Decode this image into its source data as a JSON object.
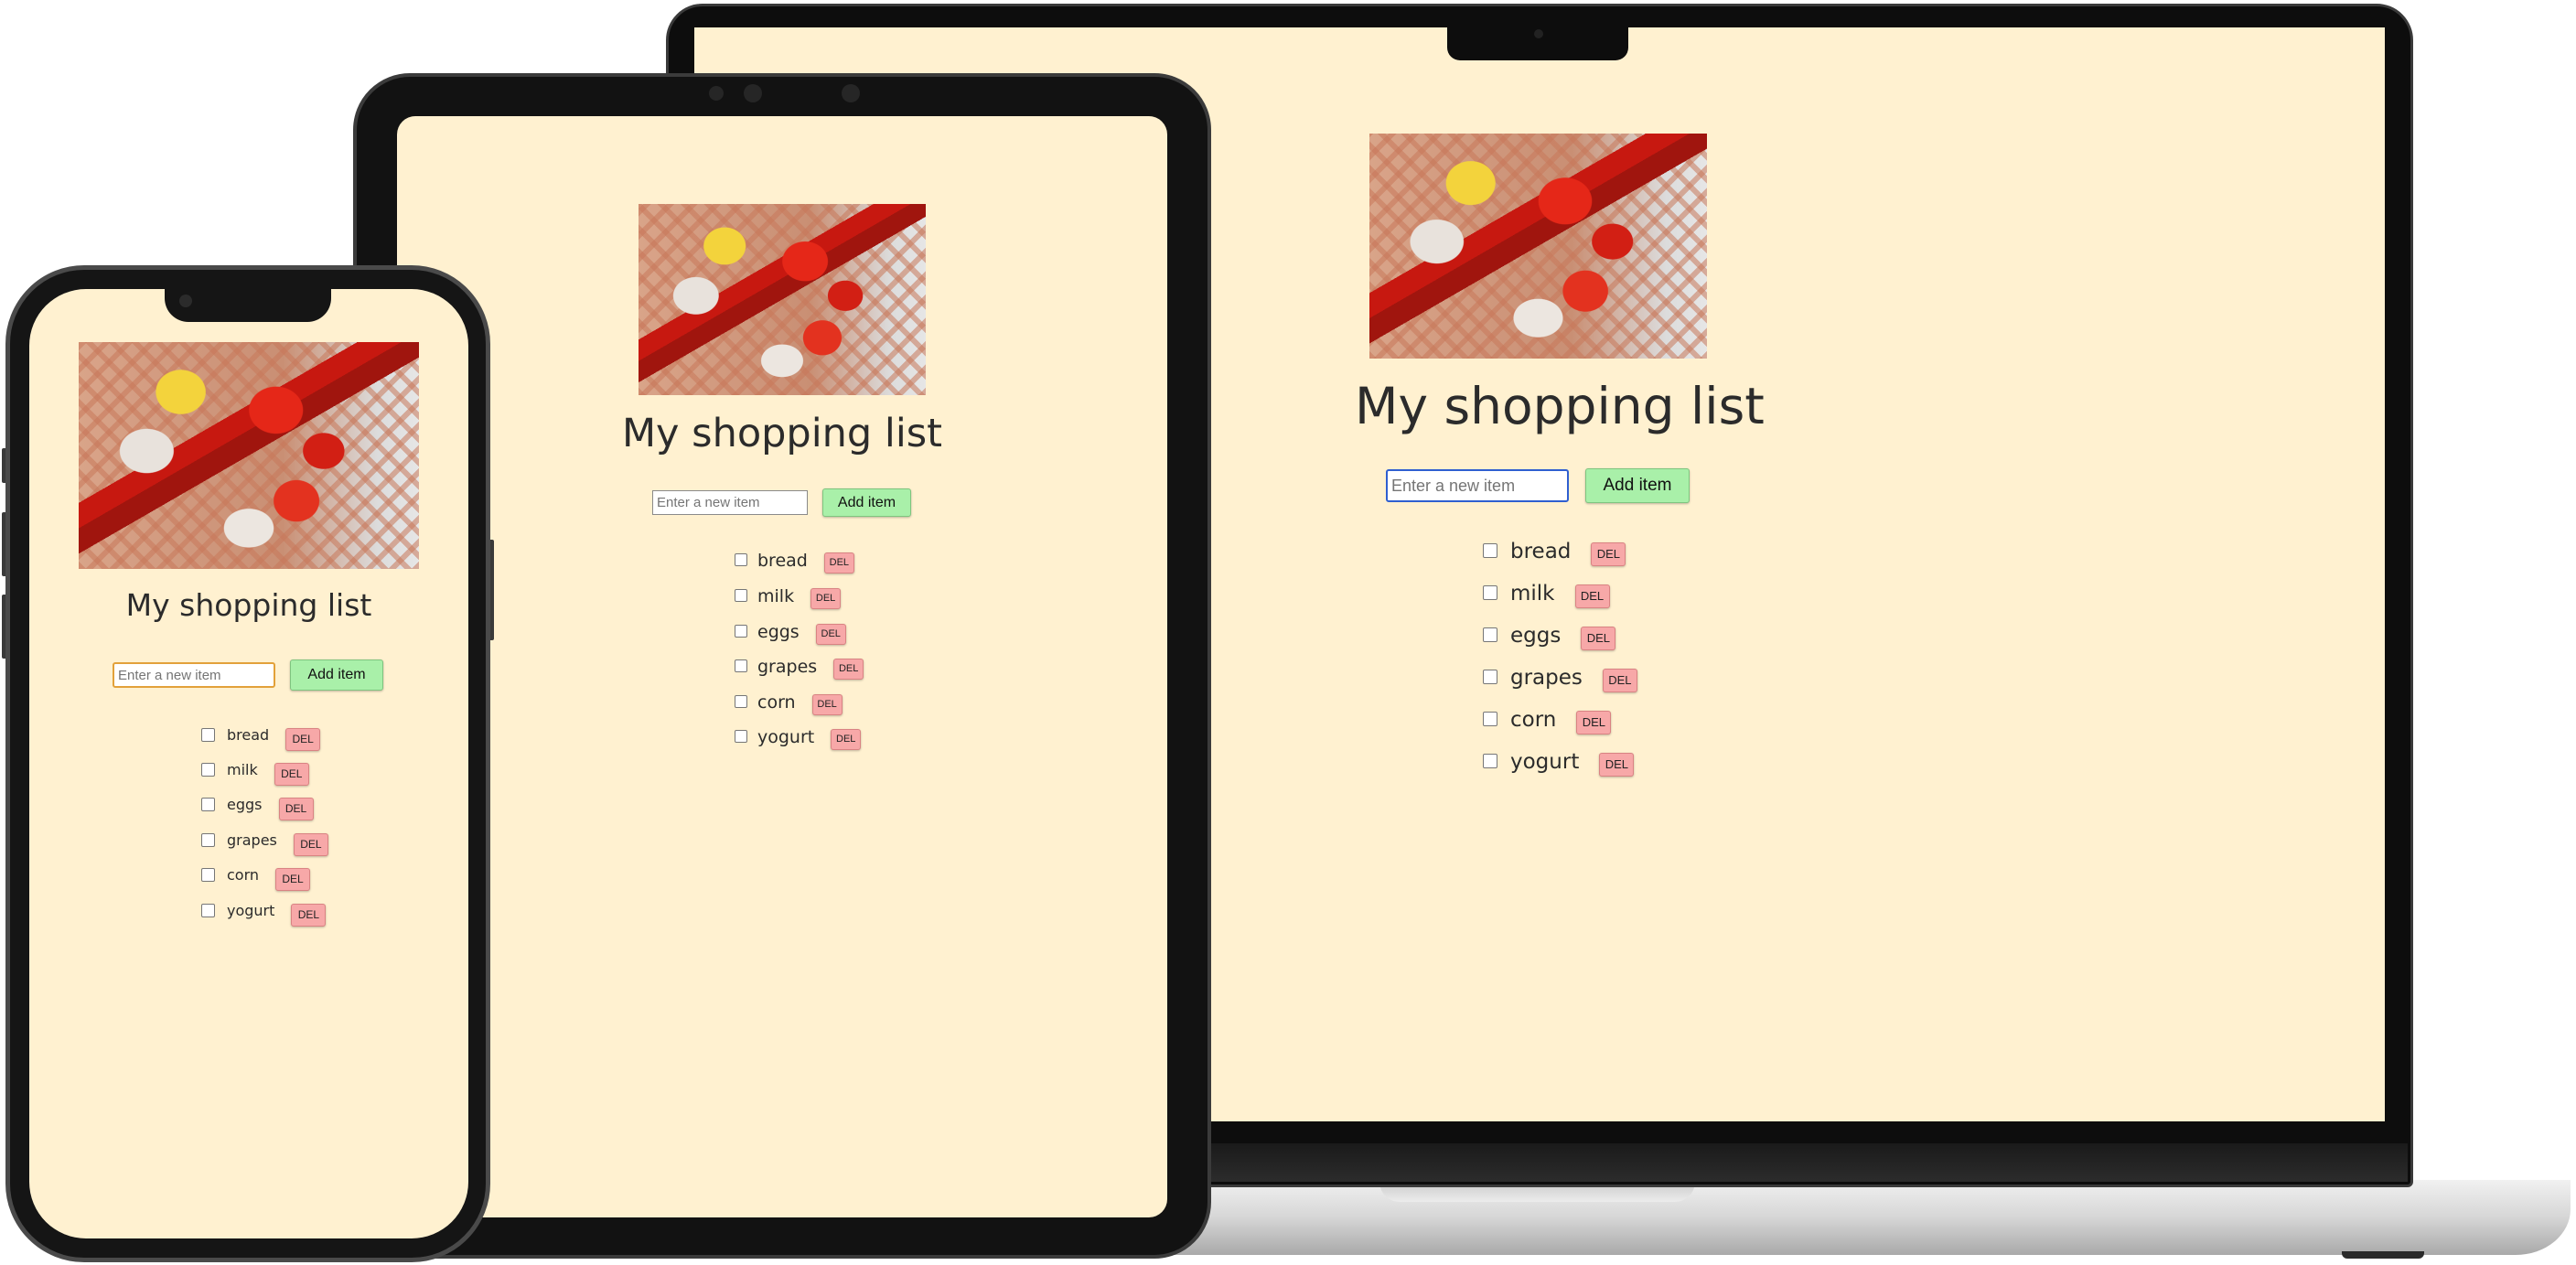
{
  "app": {
    "title": "My shopping list",
    "input_placeholder": "Enter a new item",
    "add_label": "Add item",
    "delete_label": "DEL",
    "items": [
      {
        "label": "bread",
        "checked": false
      },
      {
        "label": "milk",
        "checked": false
      },
      {
        "label": "eggs",
        "checked": false
      },
      {
        "label": "grapes",
        "checked": false
      },
      {
        "label": "corn",
        "checked": false
      },
      {
        "label": "yogurt",
        "checked": false
      }
    ]
  },
  "colors": {
    "page_background": "#fff1d0",
    "add_button": "#a9f0a9",
    "delete_button": "#f7a8a8",
    "laptop_input_focus": "#2f5fd0",
    "phone_input_focus": "#e2a13a"
  },
  "icons": {
    "hero_image": "vegetables-in-mesh-bag-photo",
    "checkbox": "checkbox-icon"
  }
}
